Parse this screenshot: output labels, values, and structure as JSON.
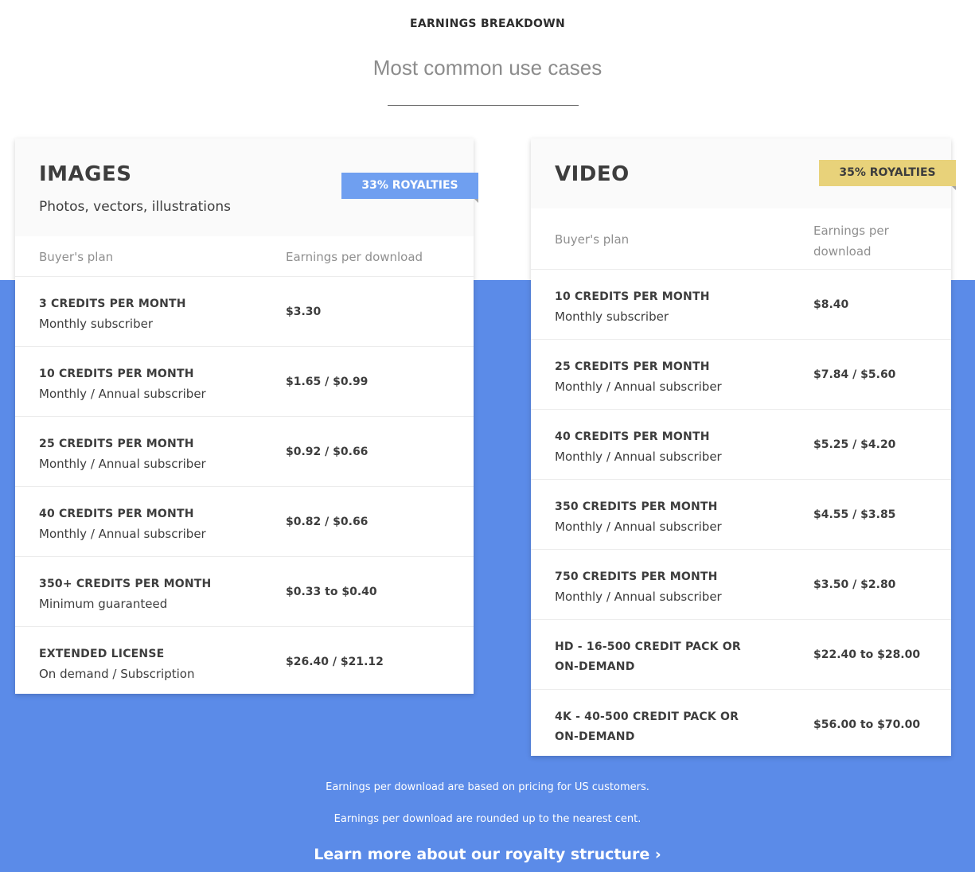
{
  "header": {
    "eyebrow": "EARNINGS BREAKDOWN",
    "headline": "Most common use cases"
  },
  "images": {
    "title": "IMAGES",
    "subtitle": "Photos, vectors, illustrations",
    "badge": "33% ROYALTIES",
    "badge_color": "#6f9ff0",
    "col_plan": "Buyer's plan",
    "col_earnings": "Earnings per download",
    "rows": [
      {
        "plan": "3 CREDITS PER MONTH",
        "desc": "Monthly subscriber",
        "price": "$3.30"
      },
      {
        "plan": "10 CREDITS PER MONTH",
        "desc": "Monthly / Annual subscriber",
        "price": "$1.65 / $0.99"
      },
      {
        "plan": "25 CREDITS PER MONTH",
        "desc": "Monthly / Annual subscriber",
        "price": "$0.92 / $0.66"
      },
      {
        "plan": "40 CREDITS PER MONTH",
        "desc": "Monthly / Annual subscriber",
        "price": "$0.82 / $0.66"
      },
      {
        "plan": "350+ CREDITS PER MONTH",
        "desc": "Minimum guaranteed",
        "price": "$0.33 to $0.40"
      },
      {
        "plan": "EXTENDED LICENSE",
        "desc": "On demand / Subscription",
        "price": "$26.40 / $21.12"
      }
    ]
  },
  "video": {
    "title": "VIDEO",
    "badge": "35% ROYALTIES",
    "badge_color": "#e8d27a",
    "col_plan": "Buyer's plan",
    "col_earnings": "Earnings per download",
    "rows": [
      {
        "plan": "10 CREDITS PER MONTH",
        "desc": "Monthly subscriber",
        "price": "$8.40"
      },
      {
        "plan": "25 CREDITS PER MONTH",
        "desc": "Monthly / Annual subscriber",
        "price": "$7.84 / $5.60"
      },
      {
        "plan": "40 CREDITS PER MONTH",
        "desc": "Monthly / Annual subscriber",
        "price": "$5.25 / $4.20"
      },
      {
        "plan": "350 CREDITS PER MONTH",
        "desc": "Monthly / Annual subscriber",
        "price": "$4.55 / $3.85"
      },
      {
        "plan": "750 CREDITS PER MONTH",
        "desc": "Monthly / Annual subscriber",
        "price": "$3.50 / $2.80"
      },
      {
        "plan": "HD - 16-500 CREDIT PACK OR ON-DEMAND",
        "desc": "",
        "price": "$22.40 to $28.00"
      },
      {
        "plan": "4K - 40-500 CREDIT PACK OR ON-DEMAND",
        "desc": "",
        "price": "$56.00 to $70.00"
      }
    ]
  },
  "footer": {
    "note_1": "Earnings per download are based on pricing for US customers.",
    "note_2": "Earnings per download are rounded up to the nearest cent.",
    "link": "Learn more about our royalty structure ›",
    "band_color": "#5b8be8"
  }
}
